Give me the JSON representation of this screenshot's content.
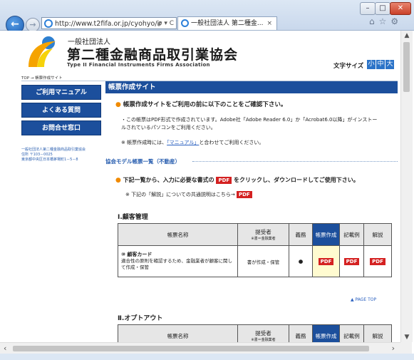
{
  "browser": {
    "url": "http://www.t2fifa.or.jp/cyohyo/ir",
    "address_tools": "ρ ▾ C",
    "tab_title": "一般社団法人 第二種金...",
    "tab_close": "×",
    "back": "←",
    "forward": "→",
    "window_buttons": {
      "minimize": "–",
      "maximize": "□",
      "close": "✕"
    },
    "toolbar_icons": "⌂☆⚙"
  },
  "header": {
    "org_small": "一般社団法人",
    "org_title": "第二種金融商品取引業協会",
    "org_en": "Type II Financial Instruments Firms Association",
    "font_size_label": "文字サイズ",
    "font_sizes": [
      "小",
      "中",
      "大"
    ]
  },
  "breadcrumb": "TOP → 帳票作成サイト",
  "sidebar": {
    "items": [
      "ご利用マニュアル",
      "よくある質問",
      "お問合せ窓口"
    ],
    "address": [
      "一般社団法人第二種金融商品取引業協会",
      "住所 〒103－0025",
      "東京都中央区日本橋茅場町1－5－8"
    ]
  },
  "main": {
    "heading": "帳票作成サイト",
    "intro": "帳票作成サイトをご利用の前に以下のことをご確認下さい。",
    "pdf_note": "・この帳票はPDF形式で作成されています。Adobe社「Adobe Reader 6.0」か「Acrobat6.0以降」がインストールされているパソコンをご利用ください。",
    "manual_note_pre": "※ 帳票作成時には、",
    "manual_link": "「マニュアル」",
    "manual_note_post": "と合わせてご利用ください。",
    "model_heading": "協会モデル帳票一覧（不動産）",
    "click_pre": "下記一覧から、入力に必要な書式の",
    "click_post": "をクリックし、ダウンロードしてご使用下さい。",
    "expl_pre": "※ 下記の「解説」についての共通説明はこちら→",
    "pdf_badge": "PDF",
    "page_top": "▲ PAGE TOP"
  },
  "table_headers": {
    "name": "帳票名称",
    "author": "提受者",
    "author_sub": "※書＝金融業者",
    "obligation": "義務",
    "create": "帳票作成",
    "example": "記載例",
    "explanation": "解説"
  },
  "sections": [
    {
      "title": "Ⅰ.顧客管理",
      "rows": [
        {
          "name": "⑩ 顧客カード",
          "description": "適合性の原則を確認するため、金融業者が顧客に関して作成・保管",
          "author": "書が作成・保管",
          "obligation": "●"
        }
      ]
    },
    {
      "title": "Ⅱ.オプトアウト",
      "rows": []
    }
  ]
}
